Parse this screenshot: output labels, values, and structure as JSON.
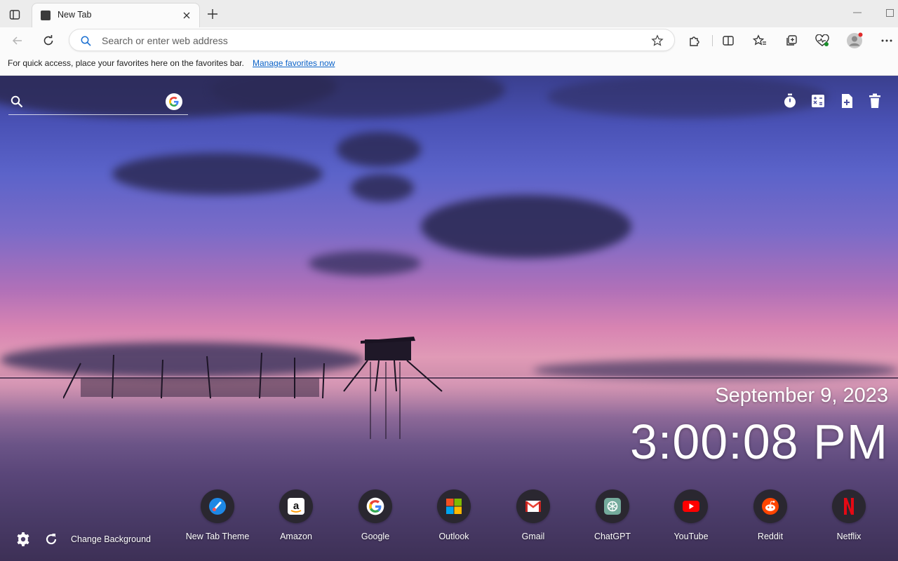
{
  "browser": {
    "tab": {
      "title": "New Tab"
    },
    "addressbar": {
      "placeholder": "Search or enter web address"
    },
    "favorites_bar": {
      "message": "For quick access, place your favorites here on the favorites bar.",
      "link": "Manage favorites now"
    },
    "icons": {
      "tab_actions": "tab-actions-icon",
      "close": "close-icon",
      "new_tab": "plus-icon",
      "minimize": "minimize-icon",
      "maximize": "maximize-icon",
      "back": "back-arrow-icon",
      "refresh": "refresh-icon",
      "search": "search-icon",
      "favorite_star": "star-icon",
      "extensions": "puzzle-icon",
      "split_screen": "split-screen-icon",
      "favorites": "favorites-icon",
      "collections": "collections-icon",
      "browser_essentials": "heart-pulse-icon",
      "profile": "avatar",
      "more": "more-icon"
    }
  },
  "newtab": {
    "search": {
      "placeholder": "",
      "engine_icon": "google-icon"
    },
    "tools": [
      "timer-icon",
      "calculator-icon",
      "note-add-icon",
      "trash-icon"
    ],
    "date": "September 9, 2023",
    "time": "3:00:08 PM",
    "shortcuts": [
      {
        "label": "New Tab Theme",
        "icon": "new-tab-theme-icon",
        "color": "#1e88e5"
      },
      {
        "label": "Amazon",
        "icon": "amazon-icon",
        "color": "#ffffff"
      },
      {
        "label": "Google",
        "icon": "google-icon",
        "color": "#ffffff"
      },
      {
        "label": "Outlook",
        "icon": "microsoft-icon",
        "color": "#f25022"
      },
      {
        "label": "Gmail",
        "icon": "gmail-icon",
        "color": "#ea4335"
      },
      {
        "label": "ChatGPT",
        "icon": "chatgpt-icon",
        "color": "#74aa9c"
      },
      {
        "label": "YouTube",
        "icon": "youtube-icon",
        "color": "#ff0000"
      },
      {
        "label": "Reddit",
        "icon": "reddit-icon",
        "color": "#ff4500"
      },
      {
        "label": "Netflix",
        "icon": "netflix-icon",
        "color": "#e50914"
      }
    ],
    "bottom": {
      "change_background": "Change Background",
      "settings_icon": "gear-icon",
      "refresh_icon": "refresh-icon"
    }
  }
}
